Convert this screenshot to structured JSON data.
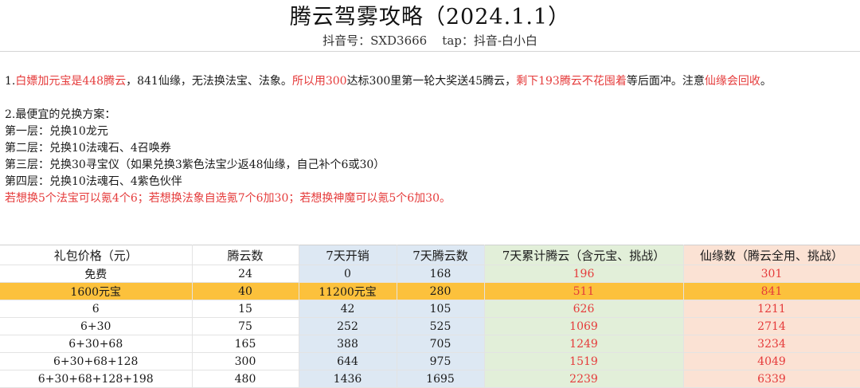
{
  "header": {
    "title": "腾云驾雾攻略（2024.1.1）",
    "subtitle": "抖音号：SXD3666    tap：抖音-白小白"
  },
  "notes": {
    "p1": [
      {
        "t": "1.",
        "red": false
      },
      {
        "t": "白嫖加元宝是448腾云",
        "red": true
      },
      {
        "t": "，841仙缘，无法换法宝、法象。",
        "red": false
      },
      {
        "t": "所以用300",
        "red": true
      },
      {
        "t": "达标300里第一轮大奖送45腾云，",
        "red": false
      },
      {
        "t": "剩下193腾云不花囤着",
        "red": true
      },
      {
        "t": "等后面冲。注意",
        "red": false
      },
      {
        "t": "仙缘会回收",
        "red": true
      },
      {
        "t": "。",
        "red": false
      }
    ],
    "p2_title": "2.最便宜的兑换方案：",
    "layer1": "第一层：兑换10龙元",
    "layer2": "第二层：兑换10法魂石、4召唤券",
    "layer3": "第三层：兑换30寻宝仪（如果兑换3紫色法宝少返48仙缘，自己补个6或30）",
    "layer4": "第四层：兑换10法魂石、4紫色伙伴",
    "tip": "若想换5个法宝可以氪4个6；若想换法象自选氪7个6加30；若想换神魔可以氪5个6加30。"
  },
  "table": {
    "headers": [
      "礼包价格（元）",
      "腾云数",
      "7天开销",
      "7天腾云数",
      "7天累计腾云（含元宝、挑战）",
      "仙缘数（腾云全用、挑战）"
    ],
    "rows": [
      [
        "免费",
        "24",
        "0",
        "168",
        "196",
        "301"
      ],
      [
        "1600元宝",
        "40",
        "11200元宝",
        "280",
        "511",
        "841"
      ],
      [
        "6",
        "15",
        "42",
        "105",
        "626",
        "1211"
      ],
      [
        "6+30",
        "75",
        "252",
        "525",
        "1069",
        "2714"
      ],
      [
        "6+30+68",
        "165",
        "388",
        "705",
        "1249",
        "3234"
      ],
      [
        "6+30+68+128",
        "300",
        "644",
        "975",
        "1519",
        "4049"
      ],
      [
        "6+30+68+128+198",
        "480",
        "1436",
        "1695",
        "2239",
        "6339"
      ]
    ],
    "highlight_row": 1,
    "colors": {
      "red": "#e53b3b",
      "blue_col": "#dde8f3",
      "green_col": "#e2efd9",
      "pink_col": "#fbe2d4",
      "highlight": "#fcc13c"
    }
  }
}
